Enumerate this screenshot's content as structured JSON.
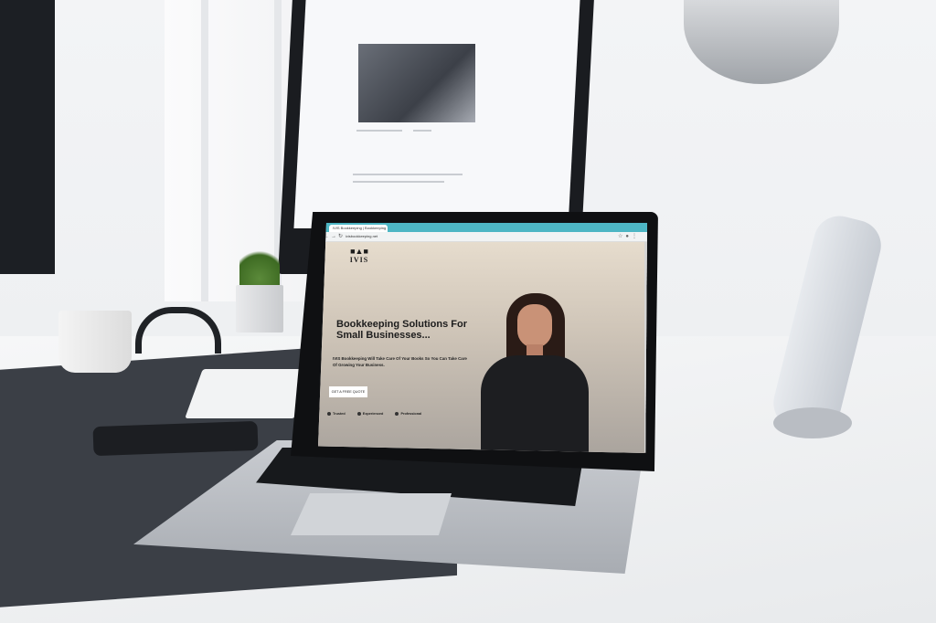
{
  "browser": {
    "tab_title": "IVIS Bookkeeping | Bookkeeping",
    "url": "ivisbookkeeping.net",
    "accent_color": "#4db6c4"
  },
  "site": {
    "logo_text": "IVIS",
    "headline": "Bookkeeping Solutions For Small Businesses...",
    "subtext": "IVIS Bookkeeping Will Take Care Of Your Books So You Can Take Care Of Growing Your Business.",
    "cta_label": "GET A FREE QUOTE",
    "badges": [
      "Trusted",
      "Experienced",
      "Professional"
    ]
  },
  "icons": {
    "nav": "back-forward-reload",
    "toolbar": "extensions-profile-menu"
  }
}
